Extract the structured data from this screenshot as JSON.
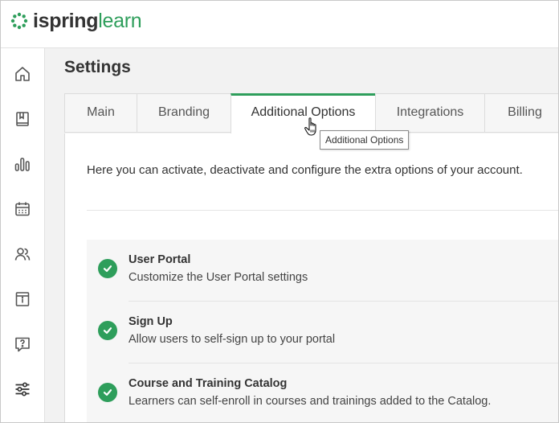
{
  "brand": {
    "name_part1": "ispring",
    "name_part2": "learn",
    "accent": "#2e9e5b"
  },
  "sidebar": {
    "items": [
      {
        "name": "home",
        "icon": "home-icon"
      },
      {
        "name": "courses",
        "icon": "book-icon"
      },
      {
        "name": "reports",
        "icon": "bar-chart-icon"
      },
      {
        "name": "calendar",
        "icon": "calendar-icon"
      },
      {
        "name": "users",
        "icon": "users-icon"
      },
      {
        "name": "info",
        "icon": "info-box-icon"
      },
      {
        "name": "help",
        "icon": "help-bubble-icon"
      },
      {
        "name": "settings",
        "icon": "sliders-icon",
        "active": true
      }
    ]
  },
  "page": {
    "title": "Settings"
  },
  "tabs": [
    {
      "label": "Main"
    },
    {
      "label": "Branding"
    },
    {
      "label": "Additional Options",
      "active": true
    },
    {
      "label": "Integrations"
    },
    {
      "label": "Billing"
    }
  ],
  "tooltip": {
    "text": "Additional Options"
  },
  "intro": "Here you can activate, deactivate and configure the extra options of your account.",
  "options": [
    {
      "title": "User Portal",
      "description": "Customize the User Portal settings",
      "enabled": true
    },
    {
      "title": "Sign Up",
      "description": "Allow users to self-sign up to your portal",
      "enabled": true
    },
    {
      "title": "Course and Training Catalog",
      "description": "Learners can self-enroll in courses and trainings added to the Catalog.",
      "enabled": true
    }
  ]
}
